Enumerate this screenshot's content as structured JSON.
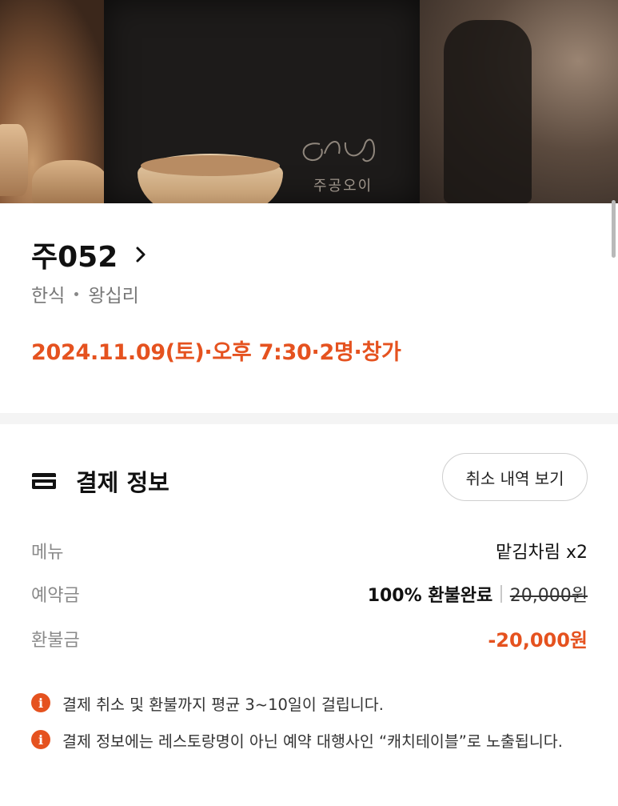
{
  "hero": {
    "logo_text": "주공오이"
  },
  "restaurant": {
    "name": "주052",
    "cuisine": "한식",
    "area": "왕십리"
  },
  "reservation": {
    "summary": "2024.11.09(토)·오후 7:30·2명·창가"
  },
  "payment": {
    "title": "결제 정보",
    "cancel_history_label": "취소 내역 보기",
    "rows": {
      "menu_label": "메뉴",
      "menu_value": "맡김차림 x2",
      "deposit_label": "예약금",
      "deposit_refund_status": "100% 환불완료",
      "deposit_original": "20,000원",
      "refund_label": "환불금",
      "refund_value": "-20,000원"
    },
    "notices": [
      "결제 취소 및 환불까지 평균 3~10일이 걸립니다.",
      "결제 정보에는 레스토랑명이 아닌 예약 대행사인 “캐치테이블”로 노출됩니다."
    ]
  },
  "colors": {
    "accent": "#e5521f",
    "muted": "#8a8a8a"
  },
  "icons": {
    "chevron": "chevron-right-icon",
    "card": "credit-card-icon",
    "info": "info-icon"
  }
}
